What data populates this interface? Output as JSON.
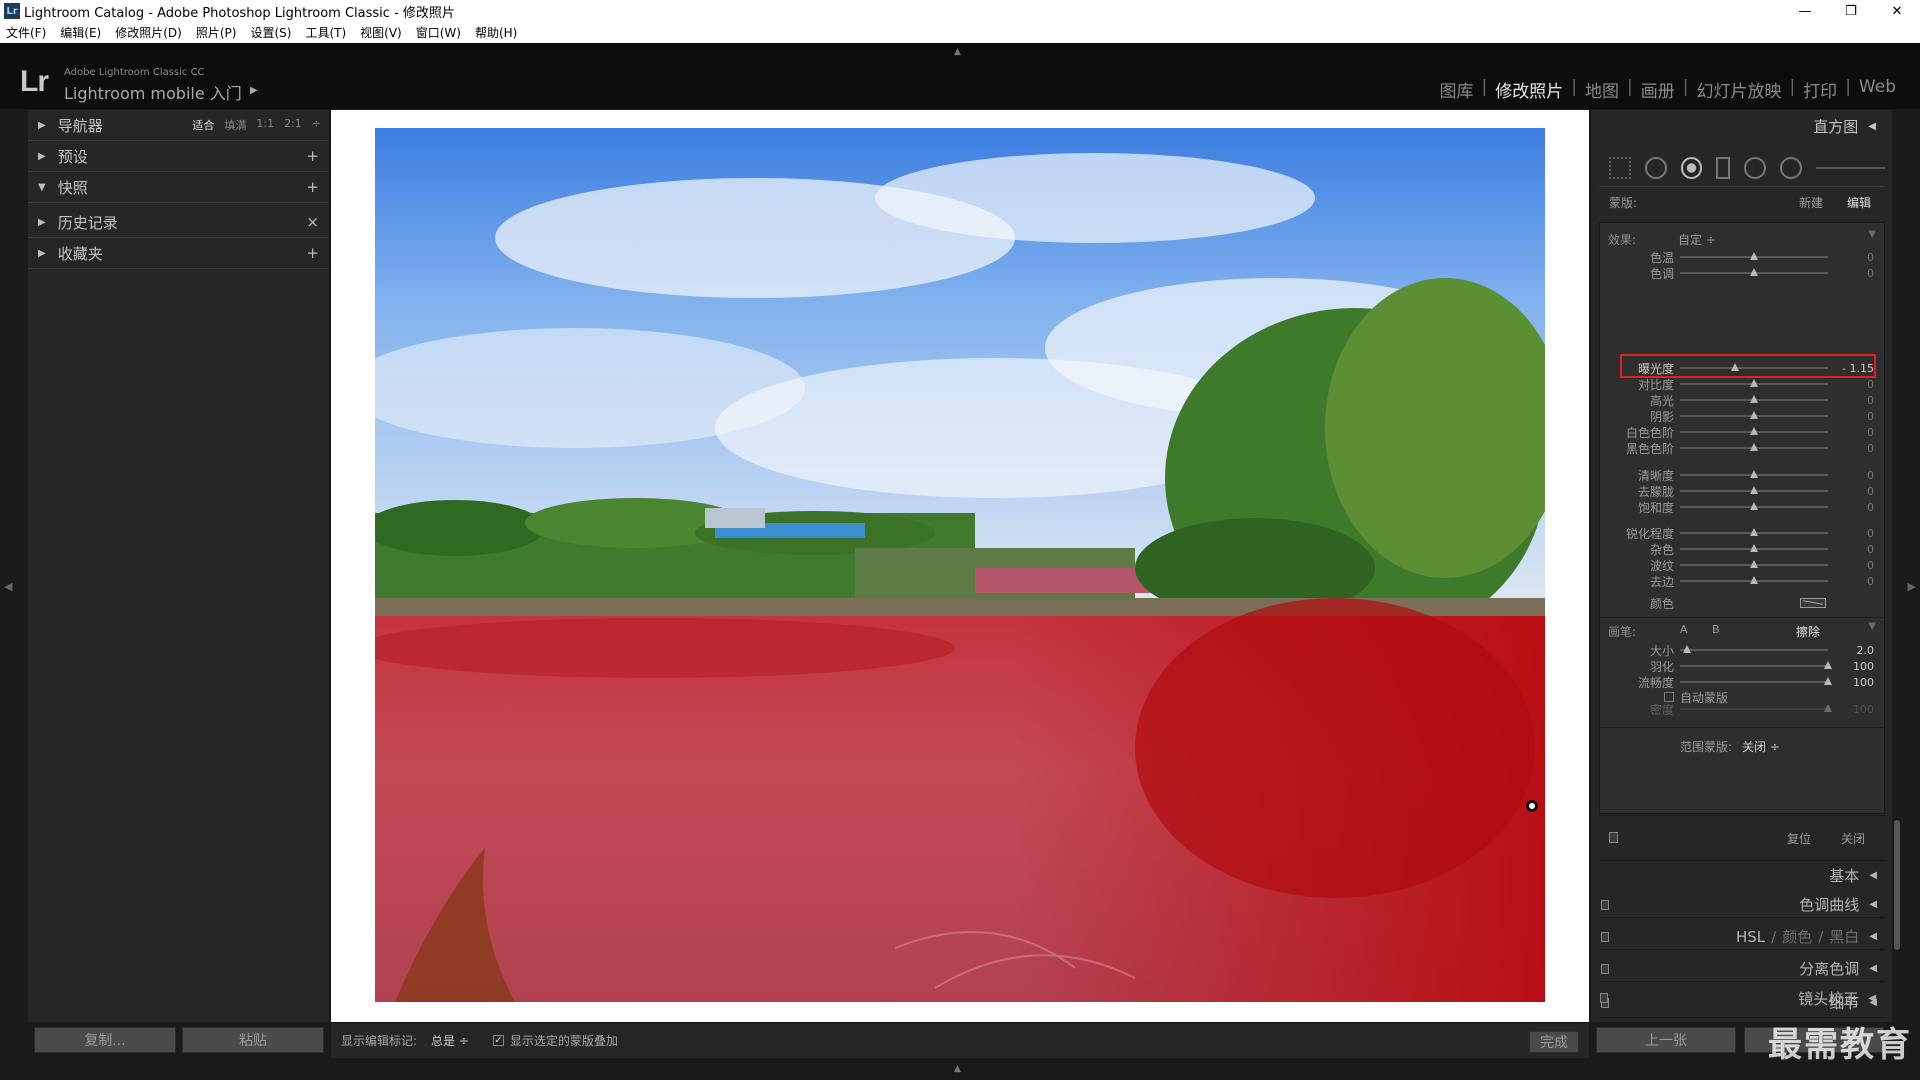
{
  "window": {
    "title": "Lightroom Catalog - Adobe Photoshop Lightroom Classic - 修改照片",
    "app_icon": "Lr",
    "minimize": "—",
    "restore": "❐",
    "close": "✕"
  },
  "menu": [
    "文件(F)",
    "编辑(E)",
    "修改照片(D)",
    "照片(P)",
    "设置(S)",
    "工具(T)",
    "视图(V)",
    "窗口(W)",
    "帮助(H)"
  ],
  "identity": {
    "logo": "Lr",
    "small": "Adobe Lightroom Classic CC",
    "big": "Lightroom mobile 入门"
  },
  "modules": [
    {
      "label": "图库",
      "active": false
    },
    {
      "label": "修改照片",
      "active": true
    },
    {
      "label": "地图",
      "active": false
    },
    {
      "label": "画册",
      "active": false
    },
    {
      "label": "幻灯片放映",
      "active": false
    },
    {
      "label": "打印",
      "active": false
    },
    {
      "label": "Web",
      "active": false
    }
  ],
  "left_panel": {
    "navigator": {
      "label": "导航器",
      "zooms": [
        "适合",
        "填满",
        "1:1",
        "2:1"
      ],
      "selected_zoom": "适合"
    },
    "sections": [
      {
        "label": "预设",
        "action": "+"
      },
      {
        "label": "快照",
        "action": "+",
        "expanded": true
      },
      {
        "label": "历史记录",
        "action": "×"
      },
      {
        "label": "收藏夹",
        "action": "+"
      }
    ],
    "copy_button": "复制...",
    "paste_button": "粘贴"
  },
  "toolbar": {
    "show_marks_label": "显示编辑标记:",
    "show_marks_value": "总是 ÷",
    "overlay_checked": "✓",
    "overlay_label": "显示选定的蒙版叠加",
    "done": "完成"
  },
  "right_panel": {
    "histogram": "直方图",
    "mask_label": "蒙版:",
    "mask_new": "新建",
    "mask_edit": "编辑",
    "effect_label": "效果:",
    "effect_value": "自定 ÷",
    "sliders_group1": [
      {
        "label": "色温",
        "value": "0",
        "pos": 0.5
      },
      {
        "label": "色调",
        "value": "0",
        "pos": 0.5
      }
    ],
    "exposure": {
      "label": "曝光度",
      "value": "- 1.15",
      "pos": 0.37
    },
    "sliders_group2": [
      {
        "label": "对比度",
        "value": "0",
        "pos": 0.5
      },
      {
        "label": "高光",
        "value": "0",
        "pos": 0.5
      },
      {
        "label": "阴影",
        "value": "0",
        "pos": 0.5
      },
      {
        "label": "白色色阶",
        "value": "0",
        "pos": 0.5
      },
      {
        "label": "黑色色阶",
        "value": "0",
        "pos": 0.5
      }
    ],
    "sliders_group3": [
      {
        "label": "清晰度",
        "value": "0",
        "pos": 0.5
      },
      {
        "label": "去朦胧",
        "value": "0",
        "pos": 0.5
      },
      {
        "label": "饱和度",
        "value": "0",
        "pos": 0.5
      }
    ],
    "sliders_group4": [
      {
        "label": "锐化程度",
        "value": "0",
        "pos": 0.5
      },
      {
        "label": "杂色",
        "value": "0",
        "pos": 0.5
      },
      {
        "label": "波纹",
        "value": "0",
        "pos": 0.5
      },
      {
        "label": "去边",
        "value": "0",
        "pos": 0.5
      }
    ],
    "color_label": "颜色",
    "brush_label": "画笔:",
    "brush_a": "A",
    "brush_b": "B",
    "brush_erase": "擦除",
    "brush_sliders": [
      {
        "label": "大小",
        "value": "2.0",
        "pos": 0.05
      },
      {
        "label": "羽化",
        "value": "100",
        "pos": 1.0
      },
      {
        "label": "流畅度",
        "value": "100",
        "pos": 1.0
      }
    ],
    "auto_mask": "自动蒙版",
    "density": {
      "label": "密度",
      "value": "100",
      "pos": 1.0
    },
    "range_mask_label": "范围蒙版:",
    "range_mask_value": "关闭 ÷",
    "reset": "复位",
    "close": "关闭",
    "sections": [
      {
        "label": "基本"
      },
      {
        "label": "色调曲线"
      },
      {
        "label": "HSL",
        "extra1": "颜色",
        "extra2": "黑白"
      },
      {
        "label": "分离色调"
      },
      {
        "label": "细节"
      },
      {
        "label": "镜头校正"
      }
    ],
    "prev_button": "上一张"
  },
  "watermark": "最需教育"
}
